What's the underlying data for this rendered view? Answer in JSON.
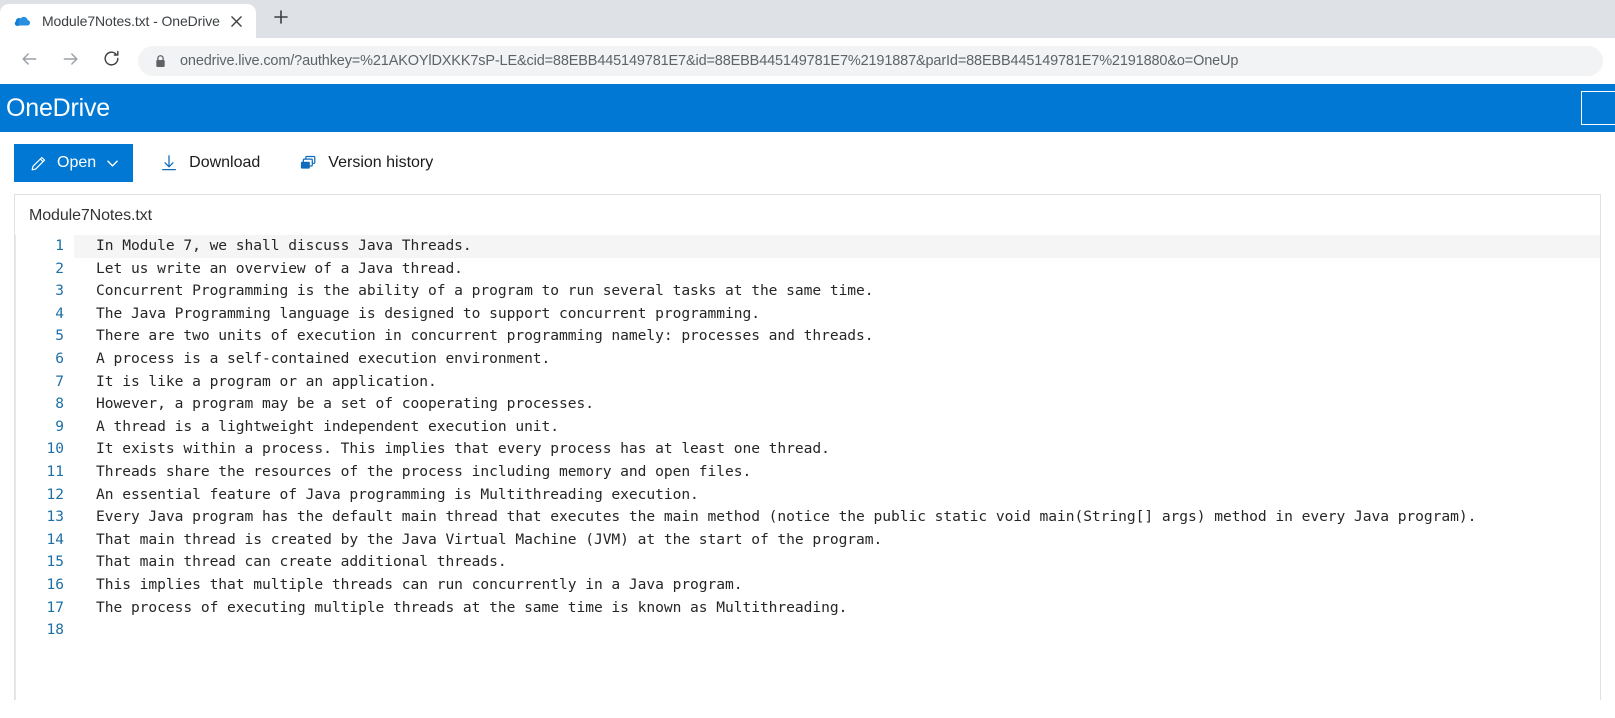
{
  "browser": {
    "tab": {
      "title": "Module7Notes.txt - OneDrive",
      "favicon": "onedrive-cloud-icon",
      "close_icon": "close-icon"
    },
    "new_tab_icon": "plus-icon",
    "nav": {
      "back_icon": "arrow-left-icon",
      "forward_icon": "arrow-right-icon",
      "reload_icon": "reload-icon"
    },
    "omnibox": {
      "lock_icon": "lock-icon",
      "url": "onedrive.live.com/?authkey=%21AKOYlDXKK7sP-LE&cid=88EBB445149781E7&id=88EBB445149781E7%2191887&parId=88EBB445149781E7%2191880&o=OneUp"
    }
  },
  "app": {
    "brand": "OneDrive",
    "brand_color": "#0078d4"
  },
  "command_bar": {
    "open": {
      "label": "Open",
      "icon": "pencil-icon",
      "chevron": "chevron-down-icon"
    },
    "download": {
      "label": "Download",
      "icon": "download-arrow-icon"
    },
    "version_history": {
      "label": "Version history",
      "icon": "version-history-icon"
    }
  },
  "viewer": {
    "filename": "Module7Notes.txt",
    "active_line": 1,
    "lines": [
      {
        "n": "1",
        "text": "In Module 7, we shall discuss Java Threads."
      },
      {
        "n": "2",
        "text": "Let us write an overview of a Java thread."
      },
      {
        "n": "3",
        "text": "Concurrent Programming is the ability of a program to run several tasks at the same time."
      },
      {
        "n": "4",
        "text": "The Java Programming language is designed to support concurrent programming."
      },
      {
        "n": "5",
        "text": "There are two units of execution in concurrent programming namely: processes and threads."
      },
      {
        "n": "6",
        "text": "A process is a self-contained execution environment."
      },
      {
        "n": "7",
        "text": "It is like a program or an application."
      },
      {
        "n": "8",
        "text": "However, a program may be a set of cooperating processes."
      },
      {
        "n": "9",
        "text": "A thread is a lightweight independent execution unit."
      },
      {
        "n": "10",
        "text": "It exists within a process. This implies that every process has at least one thread."
      },
      {
        "n": "11",
        "text": "Threads share the resources of the process including memory and open files."
      },
      {
        "n": "12",
        "text": "An essential feature of Java programming is Multithreading execution."
      },
      {
        "n": "13",
        "text": "Every Java program has the default main thread that executes the main method (notice the public static void main(String[] args) method in every Java program)."
      },
      {
        "n": "14",
        "text": "That main thread is created by the Java Virtual Machine (JVM) at the start of the program."
      },
      {
        "n": "15",
        "text": "That main thread can create additional threads."
      },
      {
        "n": "16",
        "text": "This implies that multiple threads can run concurrently in a Java program."
      },
      {
        "n": "17",
        "text": "The process of executing multiple threads at the same time is known as Multithreading."
      },
      {
        "n": "18",
        "text": ""
      }
    ]
  }
}
